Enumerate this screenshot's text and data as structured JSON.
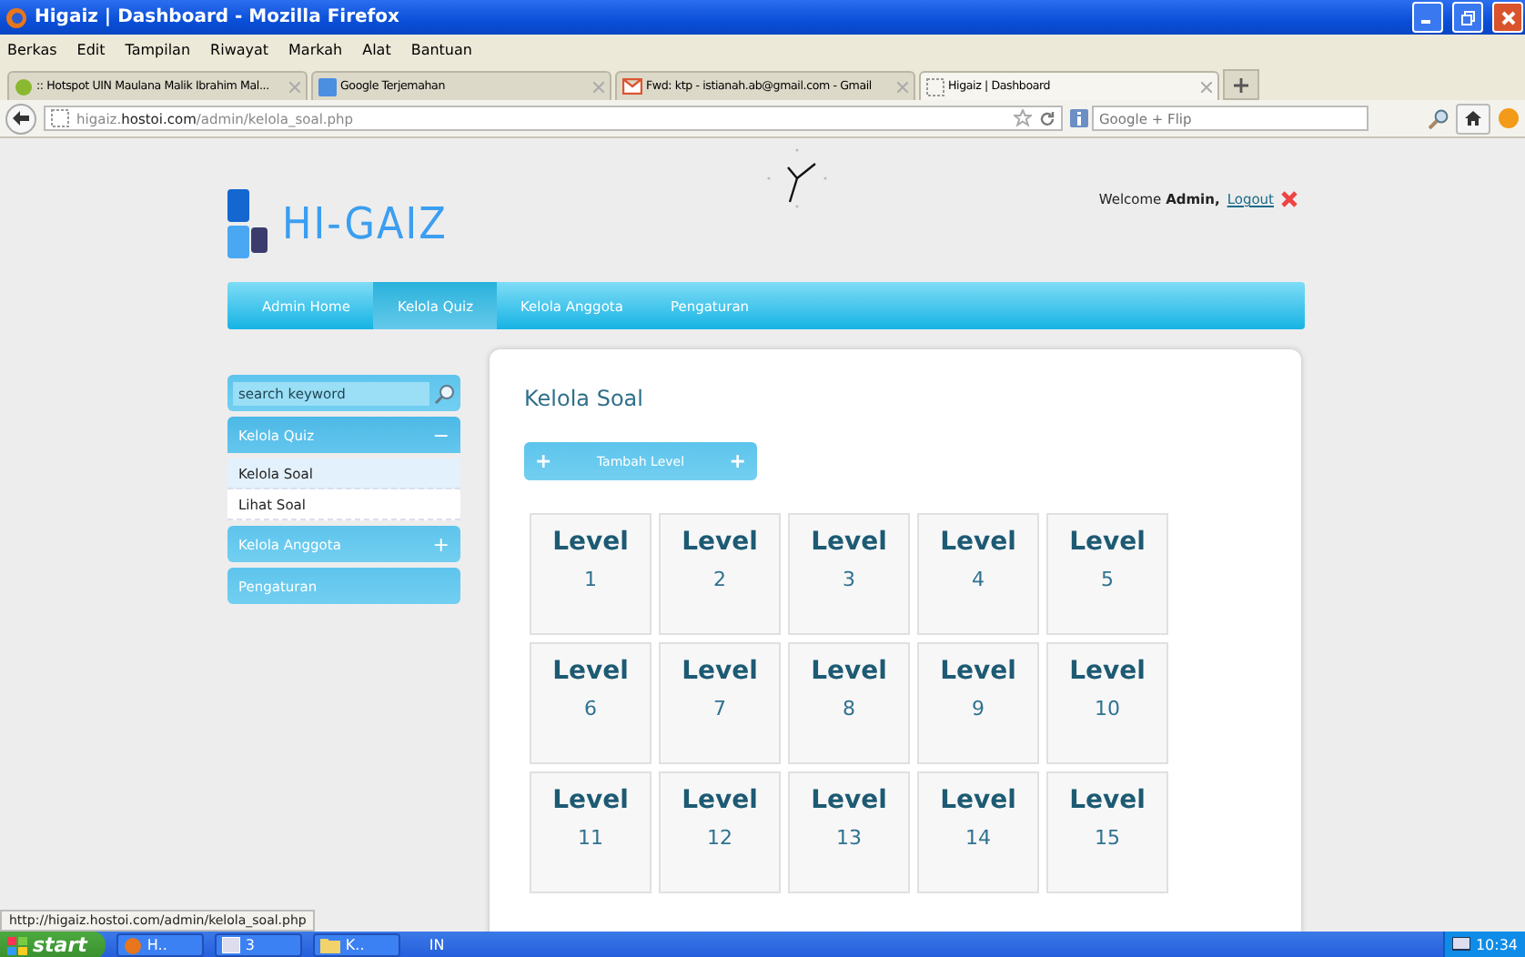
{
  "window": {
    "title": "Higaiz | Dashboard - Mozilla Firefox"
  },
  "menu": [
    "Berkas",
    "Edit",
    "Tampilan",
    "Riwayat",
    "Markah",
    "Alat",
    "Bantuan"
  ],
  "tabs": [
    {
      "label": ":: Hotspot UIN Maulana Malik Ibrahim Mal...",
      "selected": false,
      "kind": "hotspot"
    },
    {
      "label": "Google Terjemahan",
      "selected": false,
      "kind": "translate"
    },
    {
      "label": "Fwd: ktp - istianah.ab@gmail.com - Gmail",
      "selected": false,
      "kind": "gmail"
    },
    {
      "label": "Higaiz | Dashboard",
      "selected": true,
      "kind": "blank"
    }
  ],
  "address": {
    "host_prefix": "higaiz.",
    "host": "hostoi.com",
    "path": "/admin/kelola_soal.php"
  },
  "search": {
    "placeholder": "Google + Flip"
  },
  "site": {
    "logo": "HI-GAIZ",
    "welcome": "Welcome ",
    "user": "Admin,",
    "logout": "Logout",
    "nav": [
      {
        "label": "Admin Home",
        "selected": false
      },
      {
        "label": "Kelola Quiz",
        "selected": true
      },
      {
        "label": "Kelola Anggota",
        "selected": false
      },
      {
        "label": "Pengaturan",
        "selected": false
      }
    ]
  },
  "sidebar": {
    "search_placeholder": "search keyword",
    "sections": [
      {
        "label": "Kelola Quiz",
        "expanded": true,
        "toggle": "−",
        "children": [
          {
            "label": "Kelola Soal",
            "selected": true
          },
          {
            "label": "Lihat Soal",
            "selected": false
          }
        ]
      },
      {
        "label": "Kelola Anggota",
        "expanded": false,
        "toggle": "+"
      },
      {
        "label": "Pengaturan",
        "expanded": false
      }
    ]
  },
  "main": {
    "title": "Kelola Soal",
    "add_button": {
      "label": "Tambah Level",
      "icon_left": "+",
      "icon_right": "+"
    },
    "levels": [
      {
        "label": "Level",
        "number": "1"
      },
      {
        "label": "Level",
        "number": "2"
      },
      {
        "label": "Level",
        "number": "3"
      },
      {
        "label": "Level",
        "number": "4"
      },
      {
        "label": "Level",
        "number": "5"
      },
      {
        "label": "Level",
        "number": "6"
      },
      {
        "label": "Level",
        "number": "7"
      },
      {
        "label": "Level",
        "number": "8"
      },
      {
        "label": "Level",
        "number": "9"
      },
      {
        "label": "Level",
        "number": "10"
      },
      {
        "label": "Level",
        "number": "11"
      },
      {
        "label": "Level",
        "number": "12"
      },
      {
        "label": "Level",
        "number": "13"
      },
      {
        "label": "Level",
        "number": "14"
      },
      {
        "label": "Level",
        "number": "15"
      }
    ]
  },
  "status_bar": {
    "text": "http://higaiz.hostoi.com/admin/kelola_soal.php"
  },
  "taskbar": {
    "start": "start",
    "items": [
      {
        "label": "H..",
        "kind": "firefox"
      },
      {
        "label": "3",
        "kind": "group"
      },
      {
        "label": "K..",
        "kind": "folder"
      }
    ],
    "language": "IN",
    "clock": "10:34"
  }
}
